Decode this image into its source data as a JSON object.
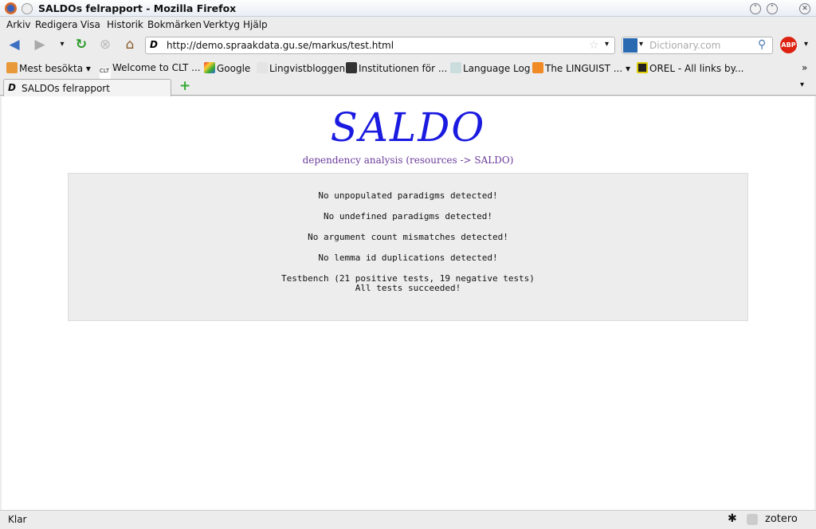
{
  "window": {
    "title": "SALDOs felrapport - Mozilla Firefox"
  },
  "menu": [
    "Arkiv",
    "Redigera",
    "Visa",
    "Historik",
    "Bokmärken",
    "Verktyg",
    "Hjälp"
  ],
  "nav": {
    "url": "http://demo.spraakdata.gu.se/markus/test.html",
    "search_placeholder": "Dictionary.com",
    "adblock_label": "ABP"
  },
  "bookmarks": [
    {
      "label": "Mest besökta ▾",
      "icon": "folder-icon",
      "color": "#e89a3a"
    },
    {
      "label": "Welcome to CLT ...",
      "icon": "clt-icon",
      "color": "#ffffff"
    },
    {
      "label": "Google",
      "icon": "google-icon",
      "color": "#3a8ee0"
    },
    {
      "label": "Lingvistbloggen",
      "icon": "sb-icon",
      "color": "#dddddd"
    },
    {
      "label": "Institutionen för ...",
      "icon": "h-icon",
      "color": "#333333"
    },
    {
      "label": "Language Log",
      "icon": "page-icon",
      "color": "#9aa"
    },
    {
      "label": "The LINGUIST ... ▾",
      "icon": "rss-icon",
      "color": "#f08a24"
    },
    {
      "label": "OREL - All links by...",
      "icon": "orel-icon",
      "color": "#222222"
    }
  ],
  "tab": {
    "label": "SALDOs felrapport"
  },
  "page": {
    "logo": "SALDO",
    "subtitle": "dependency analysis (resources -> SALDO)",
    "lines": [
      "No unpopulated paradigms detected!",
      "No undefined paradigms detected!",
      "No argument count mismatches detected!",
      "No lemma id duplications detected!",
      "Testbench (21 positive tests, 19 negative tests)",
      "All tests succeeded!"
    ]
  },
  "status": {
    "text": "Klar",
    "zotero": "zotero"
  }
}
